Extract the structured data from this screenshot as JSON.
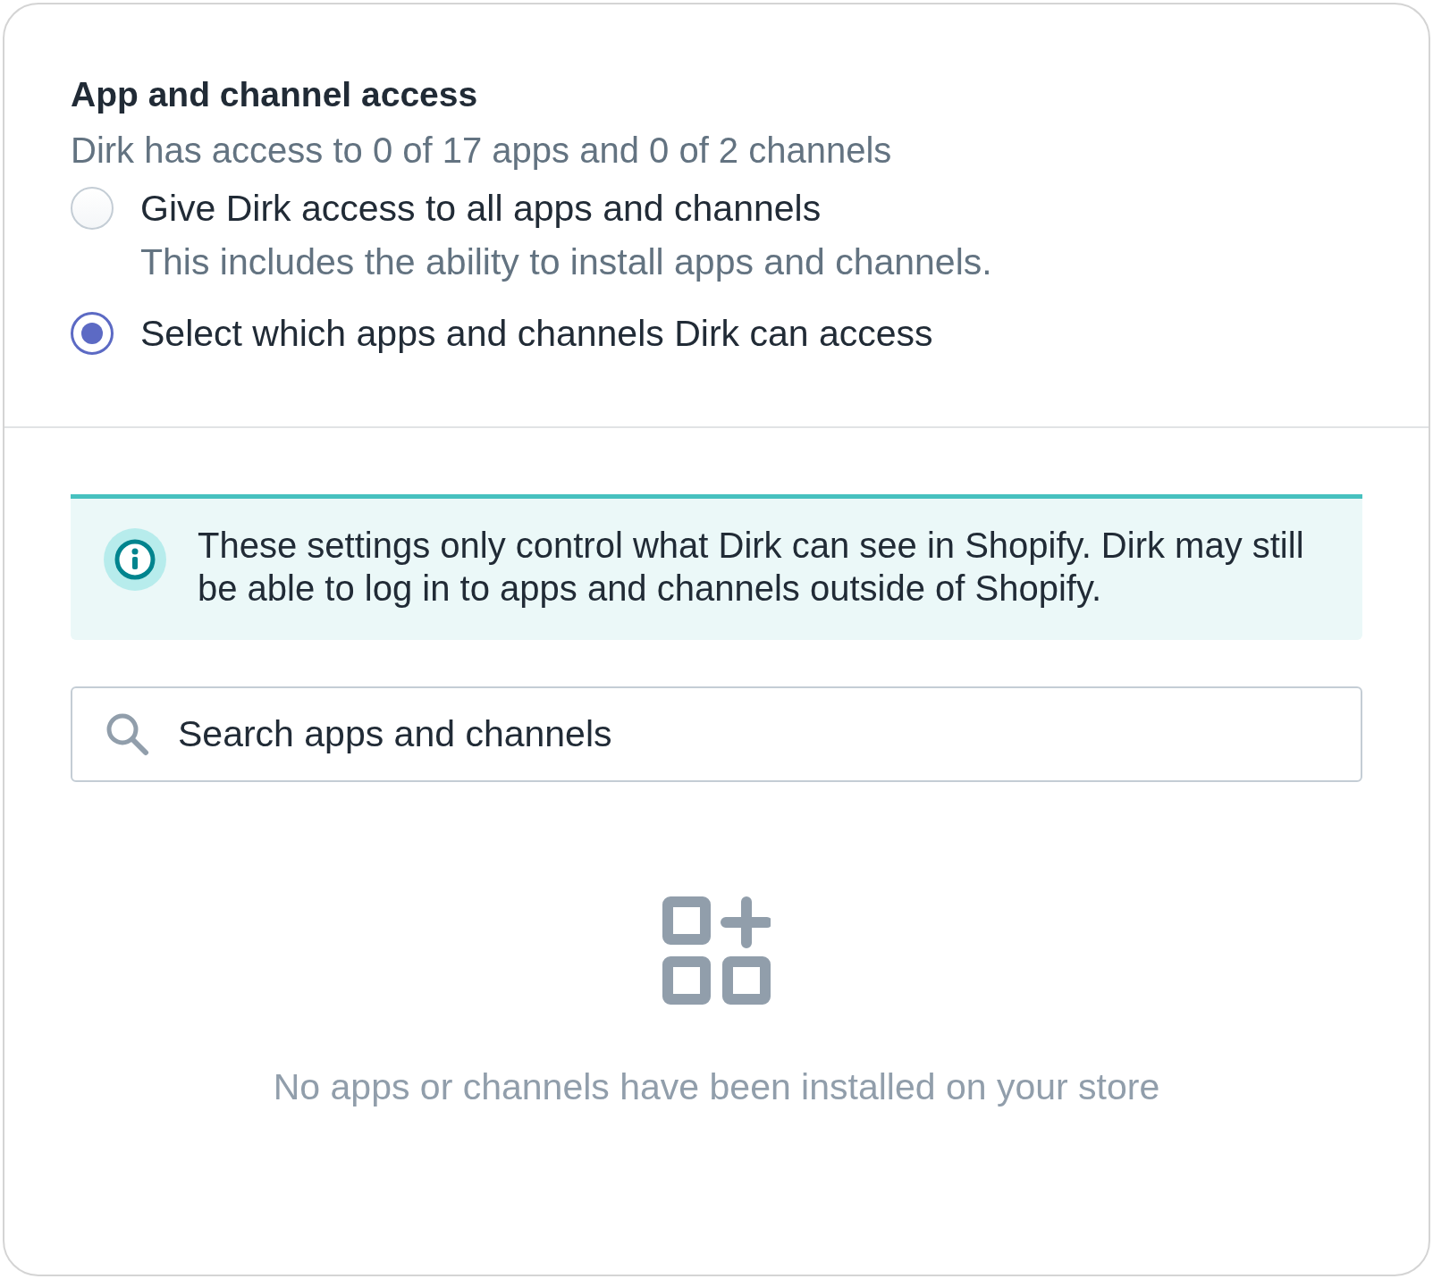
{
  "section": {
    "title": "App and channel access",
    "summary": "Dirk has access to 0 of 17 apps and 0 of 2 channels"
  },
  "options": [
    {
      "label": "Give Dirk access to all apps and channels",
      "description": "This includes the ability to install apps and channels.",
      "selected": false
    },
    {
      "label": "Select which apps and channels Dirk can access",
      "selected": true
    }
  ],
  "banner": {
    "text": "These settings only control what Dirk can see in Shopify. Dirk may still be able to log in to apps and channels outside of Shopify."
  },
  "search": {
    "placeholder": "Search apps and channels"
  },
  "empty_state": {
    "text": "No apps or channels have been installed on your store"
  }
}
